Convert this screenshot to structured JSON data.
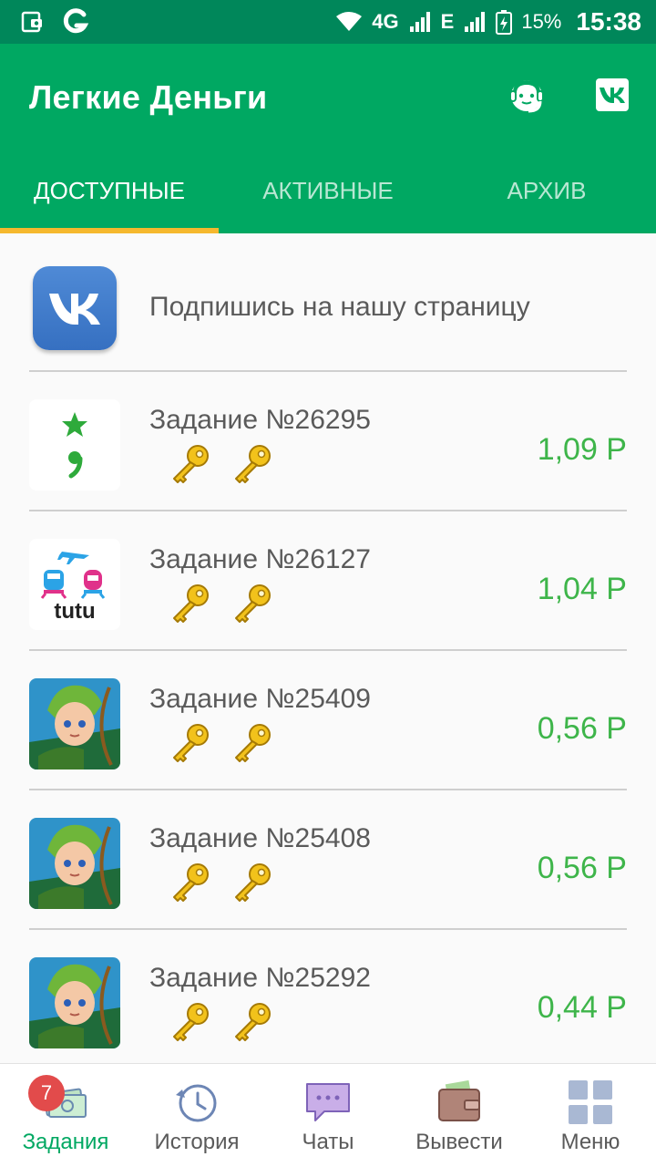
{
  "status_bar": {
    "network": "4G",
    "network2": "E",
    "battery": "15%",
    "time": "15:38"
  },
  "header": {
    "title": "Легкие Деньги",
    "support_icon": "support-agent-icon",
    "vk_icon": "vk-icon"
  },
  "tabs": [
    {
      "label": "ДОСТУПНЫЕ",
      "active": true
    },
    {
      "label": "АКТИВНЫЕ",
      "active": false
    },
    {
      "label": "АРХИВ",
      "active": false
    }
  ],
  "vk_promo": {
    "text": "Подпишись на нашу страницу"
  },
  "tasks": [
    {
      "title": "Задание №26295",
      "price": "1,09 Р",
      "icon": "star-comma-app-icon"
    },
    {
      "title": "Задание №26127",
      "price": "1,04 Р",
      "icon": "tutu-app-icon",
      "icon_text": "tutu"
    },
    {
      "title": "Задание №25409",
      "price": "0,56 Р",
      "icon": "archer-game-icon"
    },
    {
      "title": "Задание №25408",
      "price": "0,56 Р",
      "icon": "archer-game-icon"
    },
    {
      "title": "Задание №25292",
      "price": "0,44 Р",
      "icon": "archer-game-icon"
    }
  ],
  "bottom_nav": {
    "badge": "7",
    "items": [
      {
        "label": "Задания",
        "icon": "money-icon",
        "active": true
      },
      {
        "label": "История",
        "icon": "history-icon",
        "active": false
      },
      {
        "label": "Чаты",
        "icon": "chat-icon",
        "active": false
      },
      {
        "label": "Вывести",
        "icon": "wallet-icon",
        "active": false
      },
      {
        "label": "Меню",
        "icon": "grid-menu-icon",
        "active": false
      }
    ]
  },
  "colors": {
    "primary": "#00a862",
    "status_bar": "#00875a",
    "tab_indicator": "#f5b82e",
    "price": "#3eb54a",
    "badge": "#e24b4b"
  }
}
